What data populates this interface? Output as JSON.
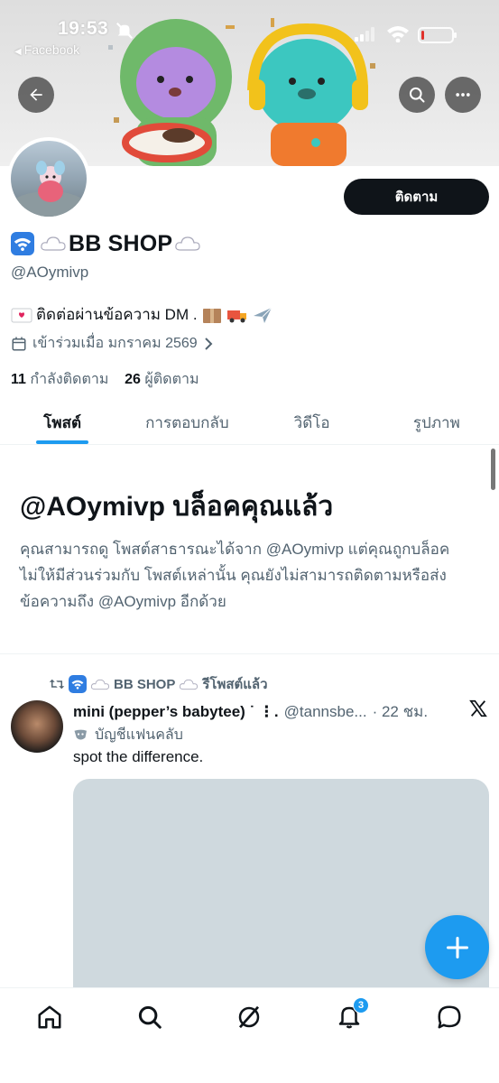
{
  "status_bar": {
    "time": "19:53",
    "back_app": "Facebook",
    "battery_level": 0.1
  },
  "profile": {
    "display_name": "BB SHOP",
    "handle": "@AOymivp",
    "follow_label": "ติดตาม",
    "bio_text": "ติดต่อผ่านข้อความ DM .",
    "joined": "เข้าร่วมเมื่อ มกราคม 2569",
    "following_count": "11",
    "following_label": "กำลังติดตาม",
    "followers_count": "26",
    "followers_label": "ผู้ติดตาม"
  },
  "tabs": [
    {
      "label": "โพสต์",
      "active": true
    },
    {
      "label": "การตอบกลับ",
      "active": false
    },
    {
      "label": "วิดีโอ",
      "active": false
    },
    {
      "label": "รูปภาพ",
      "active": false
    }
  ],
  "blocked_notice": {
    "title": "@AOymivp บล็อคคุณแล้ว",
    "description": "คุณสามารถดู โพสต์สาธารณะได้จาก @AOymivp แต่คุณถูกบล็อคไม่ให้มีส่วนร่วมกับ โพสต์เหล่านั้น คุณยังไม่สามารถติดตามหรือส่งข้อความถึง @AOymivp อีกด้วย"
  },
  "tweet": {
    "retweeter": "BB SHOP",
    "retweet_label": "รีโพสต์แล้ว",
    "author_name": "mini (pepper’s babytee) ˙ ⋮.",
    "author_handle": "@tannsbe...",
    "time": "· 22 ชม.",
    "fan_label": "บัญชีแฟนคลับ",
    "text": "spot the difference."
  },
  "bottom_nav": {
    "notification_count": "3"
  },
  "colors": {
    "accent": "#1d9bf0",
    "text_primary": "#0f1419",
    "text_secondary": "#536471",
    "follow_button": "#0f1419",
    "media_placeholder": "#cfd9de"
  }
}
